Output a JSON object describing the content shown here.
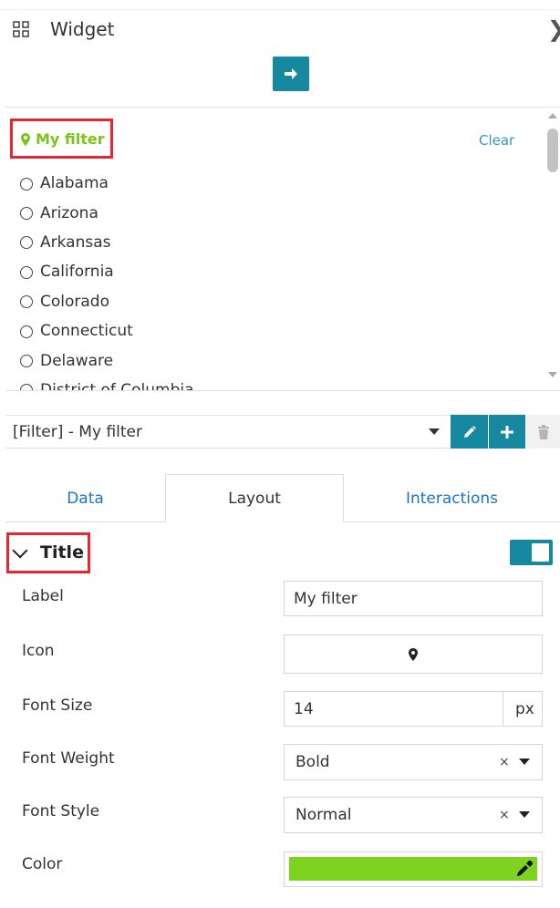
{
  "header": {
    "title": "Widget",
    "close_icon": "close-icon",
    "apply_icon": "arrow-right-icon"
  },
  "preview": {
    "filter_title": "My filter",
    "filter_icon": "map-marker-icon",
    "filter_title_color": "#7dc31a",
    "clear_label": "Clear",
    "options": [
      "Alabama",
      "Arizona",
      "Arkansas",
      "California",
      "Colorado",
      "Connecticut",
      "Delaware",
      "District of Columbia"
    ]
  },
  "filter_select": {
    "value": "[Filter] - My filter"
  },
  "tabs": [
    {
      "label": "Data"
    },
    {
      "label": "Layout"
    },
    {
      "label": "Interactions"
    }
  ],
  "active_tab": "Layout",
  "section": {
    "title": "Title",
    "enabled": true
  },
  "form": {
    "label": {
      "label": "Label",
      "value": "My filter"
    },
    "icon": {
      "label": "Icon",
      "value": "map-marker-icon"
    },
    "font_size": {
      "label": "Font Size",
      "value": "14",
      "unit": "px"
    },
    "font_weight": {
      "label": "Font Weight",
      "value": "Bold"
    },
    "font_style": {
      "label": "Font Style",
      "value": "Normal"
    },
    "color": {
      "label": "Color",
      "value": "#7dd31f"
    }
  },
  "colors": {
    "accent": "#1689a0",
    "link": "#1a73c8",
    "highlight_box": "#e8262f"
  }
}
